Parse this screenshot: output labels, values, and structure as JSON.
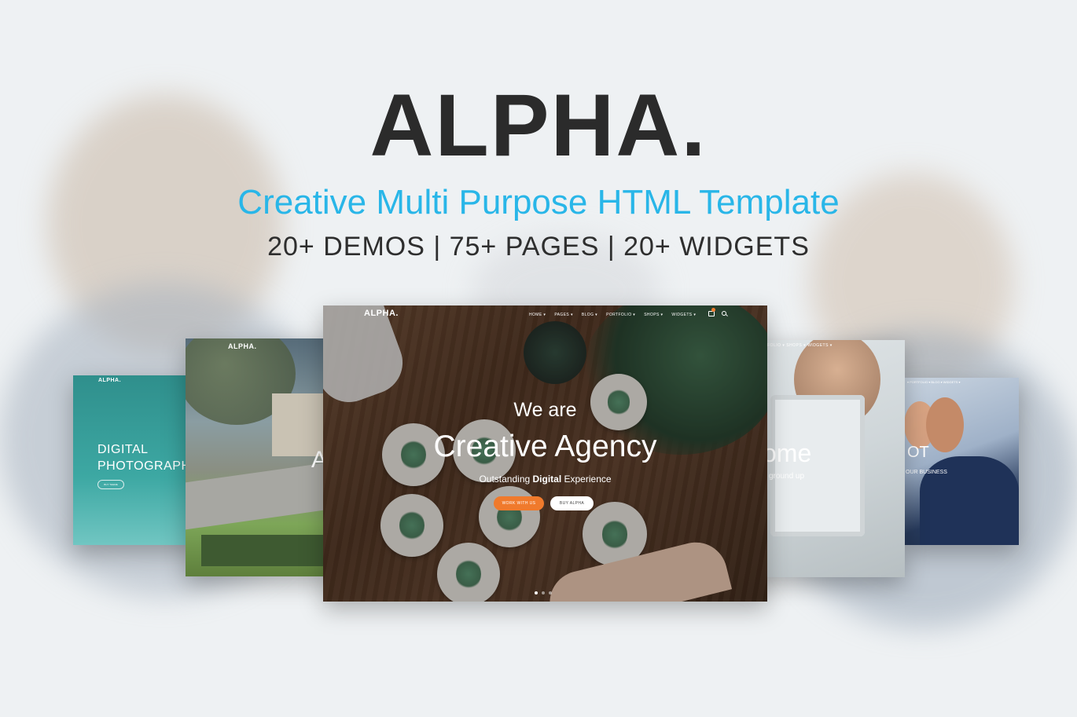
{
  "hero": {
    "title": "ALPHA.",
    "tagline": "Creative Multi Purpose HTML Template",
    "stats": "20+ DEMOS | 75+ PAGES | 20+ WIDGETS"
  },
  "card_left_far": {
    "logo": "ALPHA.",
    "headline_line1": "DIGITAL",
    "headline_line2": "PHOTOGRAPHY",
    "button": "BUY THEME"
  },
  "card_left": {
    "logo": "ALPHA.",
    "partial_text": "A"
  },
  "card_main": {
    "logo": "ALPHA.",
    "menu": [
      "HOME",
      "PAGES",
      "BLOG",
      "PORTFOLIO",
      "SHOPS",
      "WIDGETS"
    ],
    "intro": "We are",
    "headline": "Creative Agency",
    "sub_prefix": "Outstanding ",
    "sub_bold": "Digital",
    "sub_suffix": " Experience",
    "button_primary": "WORK WITH US",
    "button_secondary": "BUY ALPHA",
    "slides": 3,
    "active_slide": 1
  },
  "card_right": {
    "menu": "FOLIO ▾   SHOPS ▾   WIDGETS ▾",
    "partial_headline": "ome",
    "partial_sub": "ground up"
  },
  "card_right_far": {
    "menu": "▾   PORTFOLIO ▾   BLOG ▾   WIDGETS ▾",
    "partial_headline": "OT",
    "partial_sub": "OUR BUSINESS"
  },
  "colors": {
    "accent_blue": "#29b6e8",
    "accent_orange": "#f07a2c",
    "title_dark": "#2b2b2b"
  }
}
